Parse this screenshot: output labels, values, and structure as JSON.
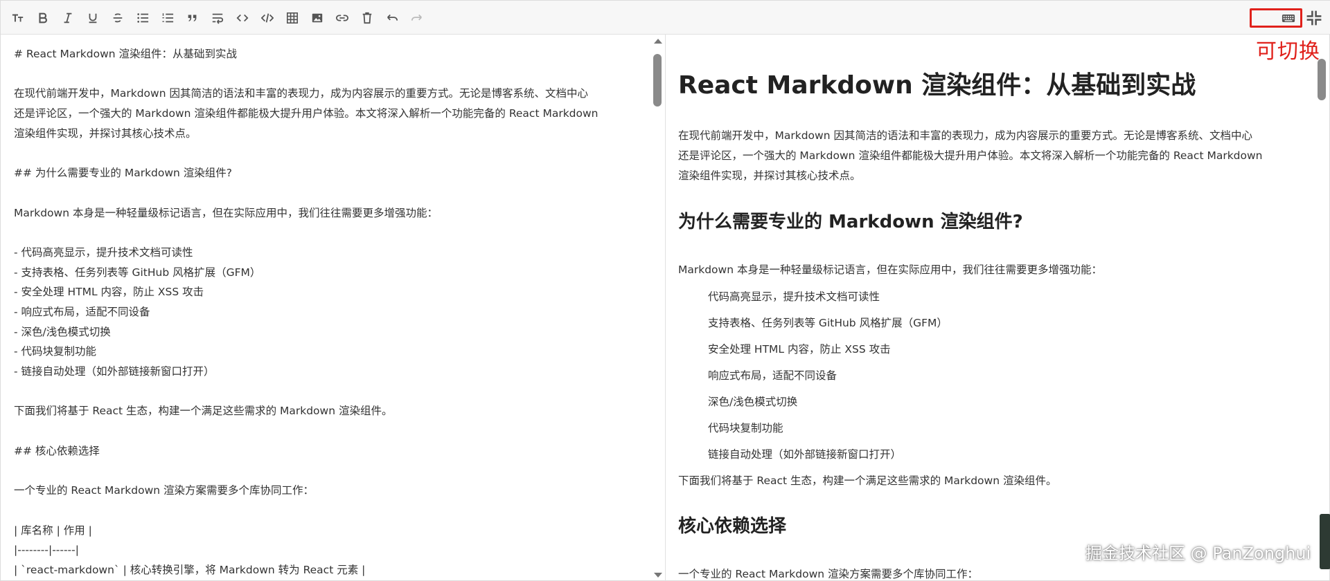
{
  "toolbar": {
    "buttons": [
      {
        "name": "heading-icon",
        "disabled": false
      },
      {
        "name": "bold-icon",
        "disabled": false
      },
      {
        "name": "italic-icon",
        "disabled": false
      },
      {
        "name": "underline-icon",
        "disabled": false
      },
      {
        "name": "strikethrough-icon",
        "disabled": false
      },
      {
        "name": "bullet-list-icon",
        "disabled": false
      },
      {
        "name": "ordered-list-icon",
        "disabled": false
      },
      {
        "name": "quote-icon",
        "disabled": false
      },
      {
        "name": "wrap-icon",
        "disabled": false
      },
      {
        "name": "inline-code-icon",
        "disabled": false
      },
      {
        "name": "code-block-icon",
        "disabled": false
      },
      {
        "name": "table-icon",
        "disabled": false
      },
      {
        "name": "image-icon",
        "disabled": false
      },
      {
        "name": "link-icon",
        "disabled": false
      },
      {
        "name": "delete-icon",
        "disabled": false
      },
      {
        "name": "undo-icon",
        "disabled": false
      },
      {
        "name": "redo-icon",
        "disabled": true
      }
    ],
    "right": [
      "keyboard-icon",
      "collapse-icon"
    ]
  },
  "annotation": {
    "toggle_label": "可切换",
    "color": "#e0211b"
  },
  "source_lines": [
    "# React Markdown 渲染组件：从基础到实战",
    "",
    "在现代前端开发中，Markdown 因其简洁的语法和丰富的表现力，成为内容展示的重要方式。无论是博客系统、文档中心",
    "还是评论区，一个强大的 Markdown 渲染组件都能极大提升用户体验。本文将深入解析一个功能完备的 React Markdown",
    "渲染组件实现，并探讨其核心技术点。",
    "",
    "## 为什么需要专业的 Markdown 渲染组件?",
    "",
    "Markdown 本身是一种轻量级标记语言，但在实际应用中，我们往往需要更多增强功能：",
    "",
    "- 代码高亮显示，提升技术文档可读性",
    "- 支持表格、任务列表等 GitHub 风格扩展（GFM）",
    "- 安全处理 HTML 内容，防止 XSS 攻击",
    "- 响应式布局，适配不同设备",
    "- 深色/浅色模式切换",
    "- 代码块复制功能",
    "- 链接自动处理（如外部链接新窗口打开）",
    "",
    "下面我们将基于 React 生态，构建一个满足这些需求的 Markdown 渲染组件。",
    "",
    "## 核心依赖选择",
    "",
    "一个专业的 React Markdown 渲染方案需要多个库协同工作：",
    "",
    "| 库名称 | 作用 |",
    "|--------|------|",
    "| `react-markdown` | 核心转换引擎，将 Markdown 转为 React 元素 |"
  ],
  "preview": {
    "h1": "React Markdown 渲染组件：从基础到实战",
    "intro_lines": [
      "在现代前端开发中，Markdown 因其简洁的语法和丰富的表现力，成为内容展示的重要方式。无论是博客系统、文档中心",
      "还是评论区，一个强大的 Markdown 渲染组件都能极大提升用户体验。本文将深入解析一个功能完备的 React Markdown",
      "渲染组件实现，并探讨其核心技术点。"
    ],
    "h2_why": "为什么需要专业的 Markdown 渲染组件?",
    "why_p": "Markdown 本身是一种轻量级标记语言，但在实际应用中，我们往往需要更多增强功能：",
    "list": [
      "代码高亮显示，提升技术文档可读性",
      "支持表格、任务列表等 GitHub 风格扩展（GFM）",
      "安全处理 HTML 内容，防止 XSS 攻击",
      "响应式布局，适配不同设备",
      "深色/浅色模式切换",
      "代码块复制功能",
      "链接自动处理（如外部链接新窗口打开）"
    ],
    "after_list": "下面我们将基于 React 生态，构建一个满足这些需求的 Markdown 渲染组件。",
    "h2_deps": "核心依赖选择",
    "deps_p": "一个专业的 React Markdown 渲染方案需要多个库协同工作："
  },
  "watermark": "掘金技术社区 @ PanZonghui"
}
